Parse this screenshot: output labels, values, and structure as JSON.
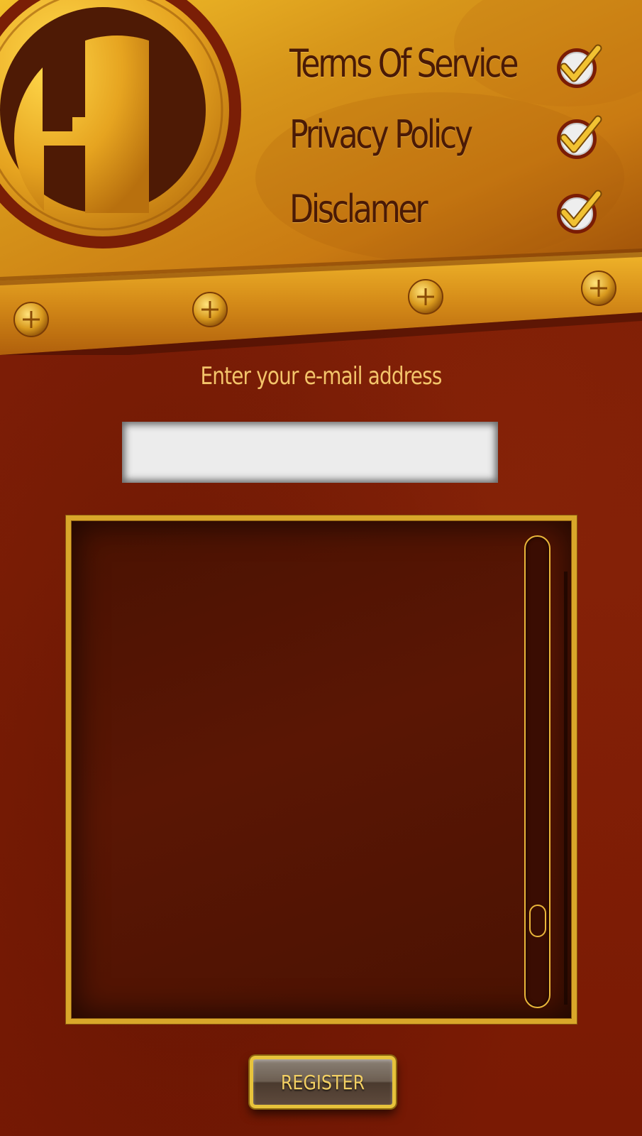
{
  "agreements": [
    {
      "label": "Terms Of Service",
      "checked": true
    },
    {
      "label": "Privacy Policy",
      "checked": true
    },
    {
      "label": "Disclamer",
      "checked": true
    }
  ],
  "email": {
    "label": "Enter your e-mail address",
    "value": "",
    "placeholder": ""
  },
  "terms_box": {
    "text": "",
    "scroll_position": 0.85
  },
  "register": {
    "label": "REGISTER"
  },
  "icons": {
    "logo": "h-letter-logo-icon",
    "check": "checkmark-icon",
    "rivet": "rivet-icon"
  },
  "colors": {
    "gold": "#e0a020",
    "dark_red": "#7a1c05",
    "label_text": "#f3c46a",
    "agreement_text": "#4a1a06"
  }
}
